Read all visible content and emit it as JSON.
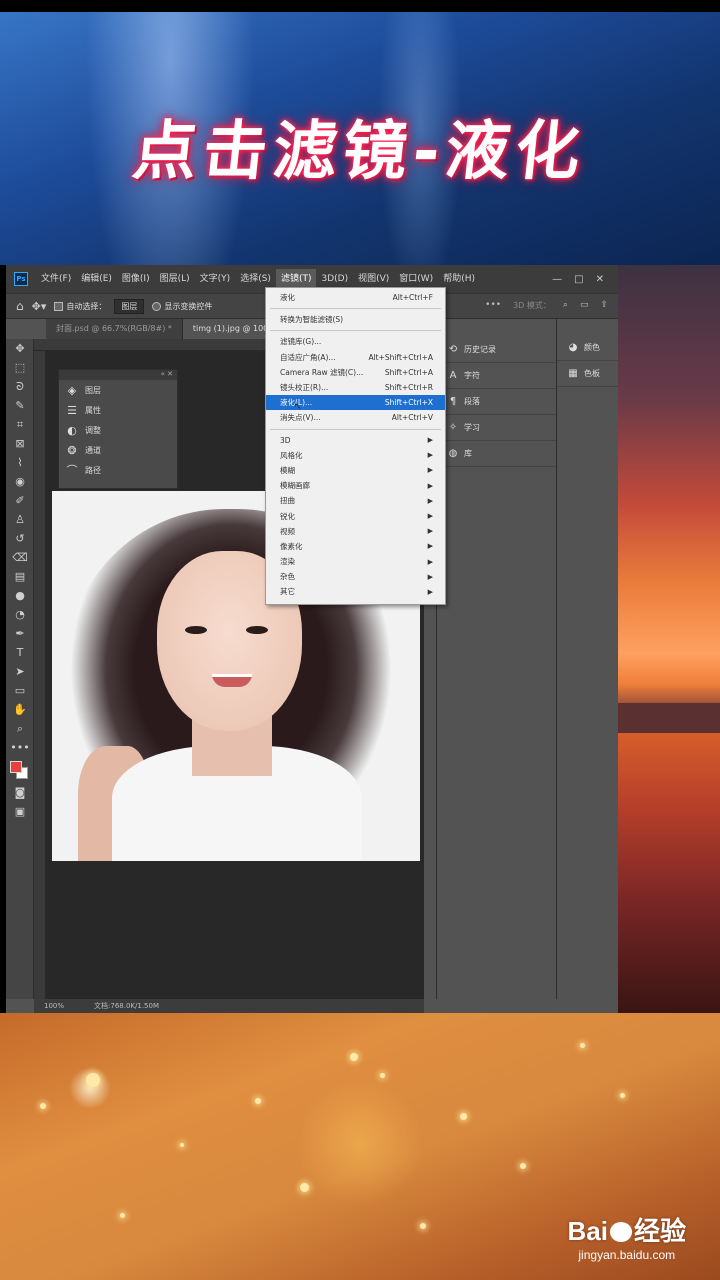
{
  "banner": {
    "title": "点击滤镜-液化"
  },
  "menubar": {
    "logo": "Ps",
    "items": [
      "文件(F)",
      "编辑(E)",
      "图像(I)",
      "图层(L)",
      "文字(Y)",
      "选择(S)",
      "滤镜(T)",
      "3D(D)",
      "视图(V)",
      "窗口(W)",
      "帮助(H)"
    ],
    "window_controls": [
      "—",
      "□",
      "✕"
    ]
  },
  "options_bar": {
    "auto_select_label": "自动选择：",
    "auto_select_value": "图层",
    "show_transform_label": "显示变换控件",
    "right_items": [
      "•••",
      "3D 模式：",
      "⌕",
      "▭",
      "⇪"
    ]
  },
  "tabs": [
    "封面.psd @ 66.7%(RGB/8#) *",
    "timg (1).jpg @ 100%"
  ],
  "float_panel": {
    "items": [
      {
        "icon": "layers-icon",
        "label": "图层"
      },
      {
        "icon": "properties-icon",
        "label": "属性"
      },
      {
        "icon": "adjustments-icon",
        "label": "调整"
      },
      {
        "icon": "channels-icon",
        "label": "通道"
      },
      {
        "icon": "paths-icon",
        "label": "路径"
      }
    ]
  },
  "dock1": {
    "items": [
      {
        "icon": "history-icon",
        "label": "历史记录"
      },
      {
        "icon": "character-icon",
        "label": "字符"
      },
      {
        "icon": "paragraph-icon",
        "label": "段落"
      },
      {
        "icon": "learn-icon",
        "label": "学习"
      },
      {
        "icon": "libraries-icon",
        "label": "库"
      }
    ]
  },
  "dock2": {
    "items": [
      {
        "icon": "color-icon",
        "label": "颜色"
      },
      {
        "icon": "swatches-icon",
        "label": "色板"
      }
    ]
  },
  "statusbar": {
    "zoom": "100%",
    "doc": "文档:768.0K/1.50M"
  },
  "filter_menu": {
    "top": [
      {
        "label": "液化",
        "shortcut": "Alt+Ctrl+F"
      }
    ],
    "convert": {
      "label": "转换为智能滤镜(S)"
    },
    "filters": [
      {
        "label": "滤镜库(G)...",
        "shortcut": ""
      },
      {
        "label": "自适应广角(A)...",
        "shortcut": "Alt+Shift+Ctrl+A"
      },
      {
        "label": "Camera Raw 滤镜(C)...",
        "shortcut": "Shift+Ctrl+A"
      },
      {
        "label": "镜头校正(R)...",
        "shortcut": "Shift+Ctrl+R"
      },
      {
        "label": "液化(L)...",
        "shortcut": "Shift+Ctrl+X"
      },
      {
        "label": "消失点(V)...",
        "shortcut": "Alt+Ctrl+V"
      }
    ],
    "submenus": [
      "3D",
      "风格化",
      "模糊",
      "模糊画廊",
      "扭曲",
      "锐化",
      "视频",
      "像素化",
      "渲染",
      "杂色",
      "其它"
    ]
  },
  "watermark": {
    "main": "Bai",
    "main2": "经验",
    "sub": "jingyan.baidu.com"
  }
}
